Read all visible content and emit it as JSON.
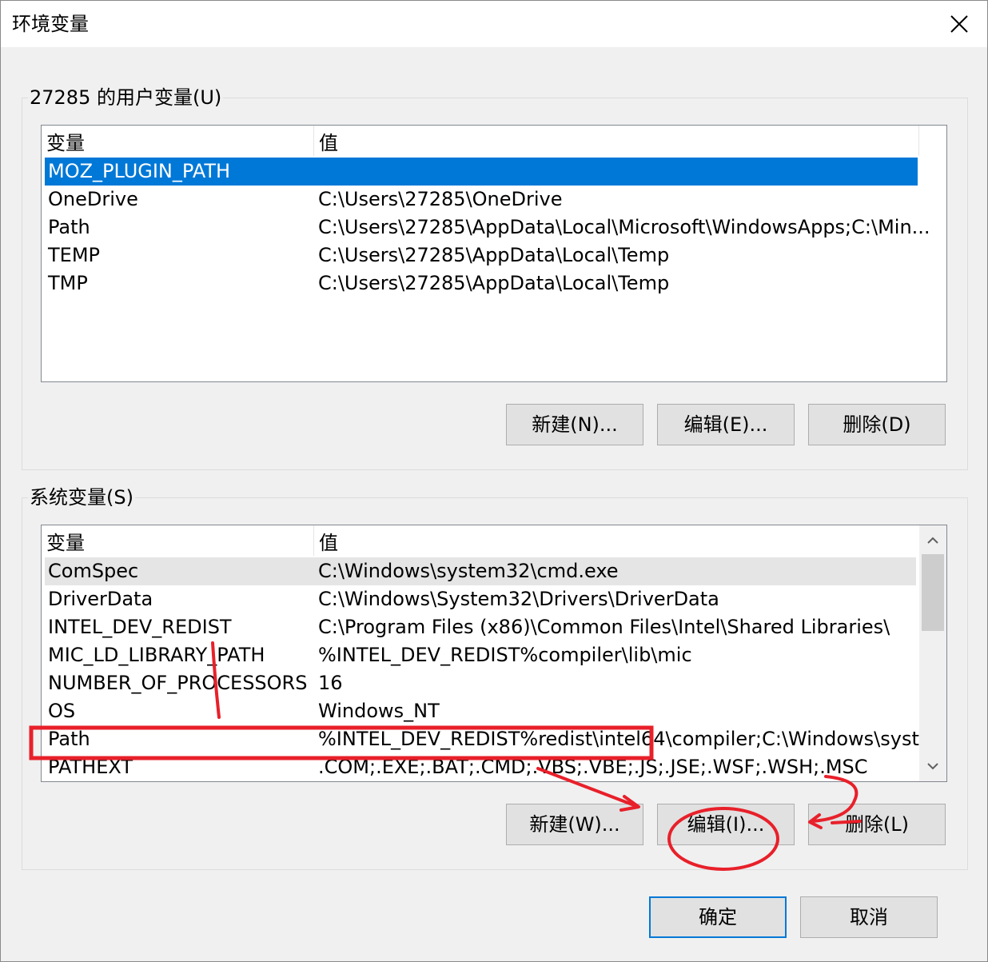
{
  "window": {
    "title": "环境变量"
  },
  "user_vars": {
    "group_title": "27285 的用户变量(U)",
    "col_name": "变量",
    "col_value": "值",
    "rows": [
      {
        "name": "MOZ_PLUGIN_PATH",
        "value": ""
      },
      {
        "name": "OneDrive",
        "value": "C:\\Users\\27285\\OneDrive"
      },
      {
        "name": "Path",
        "value": "C:\\Users\\27285\\AppData\\Local\\Microsoft\\WindowsApps;C:\\Min..."
      },
      {
        "name": "TEMP",
        "value": "C:\\Users\\27285\\AppData\\Local\\Temp"
      },
      {
        "name": "TMP",
        "value": "C:\\Users\\27285\\AppData\\Local\\Temp"
      }
    ],
    "selected_index": 0,
    "new_label": "新建(N)...",
    "edit_label": "编辑(E)...",
    "delete_label": "删除(D)"
  },
  "system_vars": {
    "group_title": "系统变量(S)",
    "col_name": "变量",
    "col_value": "值",
    "rows": [
      {
        "name": "ComSpec",
        "value": "C:\\Windows\\system32\\cmd.exe"
      },
      {
        "name": "DriverData",
        "value": "C:\\Windows\\System32\\Drivers\\DriverData"
      },
      {
        "name": "INTEL_DEV_REDIST",
        "value": "C:\\Program Files (x86)\\Common Files\\Intel\\Shared Libraries\\"
      },
      {
        "name": "MIC_LD_LIBRARY_PATH",
        "value": "%INTEL_DEV_REDIST%compiler\\lib\\mic"
      },
      {
        "name": "NUMBER_OF_PROCESSORS",
        "value": "16"
      },
      {
        "name": "OS",
        "value": "Windows_NT"
      },
      {
        "name": "Path",
        "value": "%INTEL_DEV_REDIST%redist\\intel64\\compiler;C:\\Windows\\syst..."
      },
      {
        "name": "PATHEXT",
        "value": ".COM;.EXE;.BAT;.CMD;.VBS;.VBE;.JS;.JSE;.WSF;.WSH;.MSC"
      }
    ],
    "new_label": "新建(W)...",
    "edit_label": "编辑(I)...",
    "delete_label": "删除(L)"
  },
  "footer": {
    "ok_label": "确定",
    "cancel_label": "取消"
  },
  "icons": {
    "close": "close-icon",
    "scroll_up": "chevron-up-icon",
    "scroll_down": "chevron-down-icon"
  },
  "colors": {
    "selection": "#0078d7",
    "annotation": "#e8202a"
  }
}
